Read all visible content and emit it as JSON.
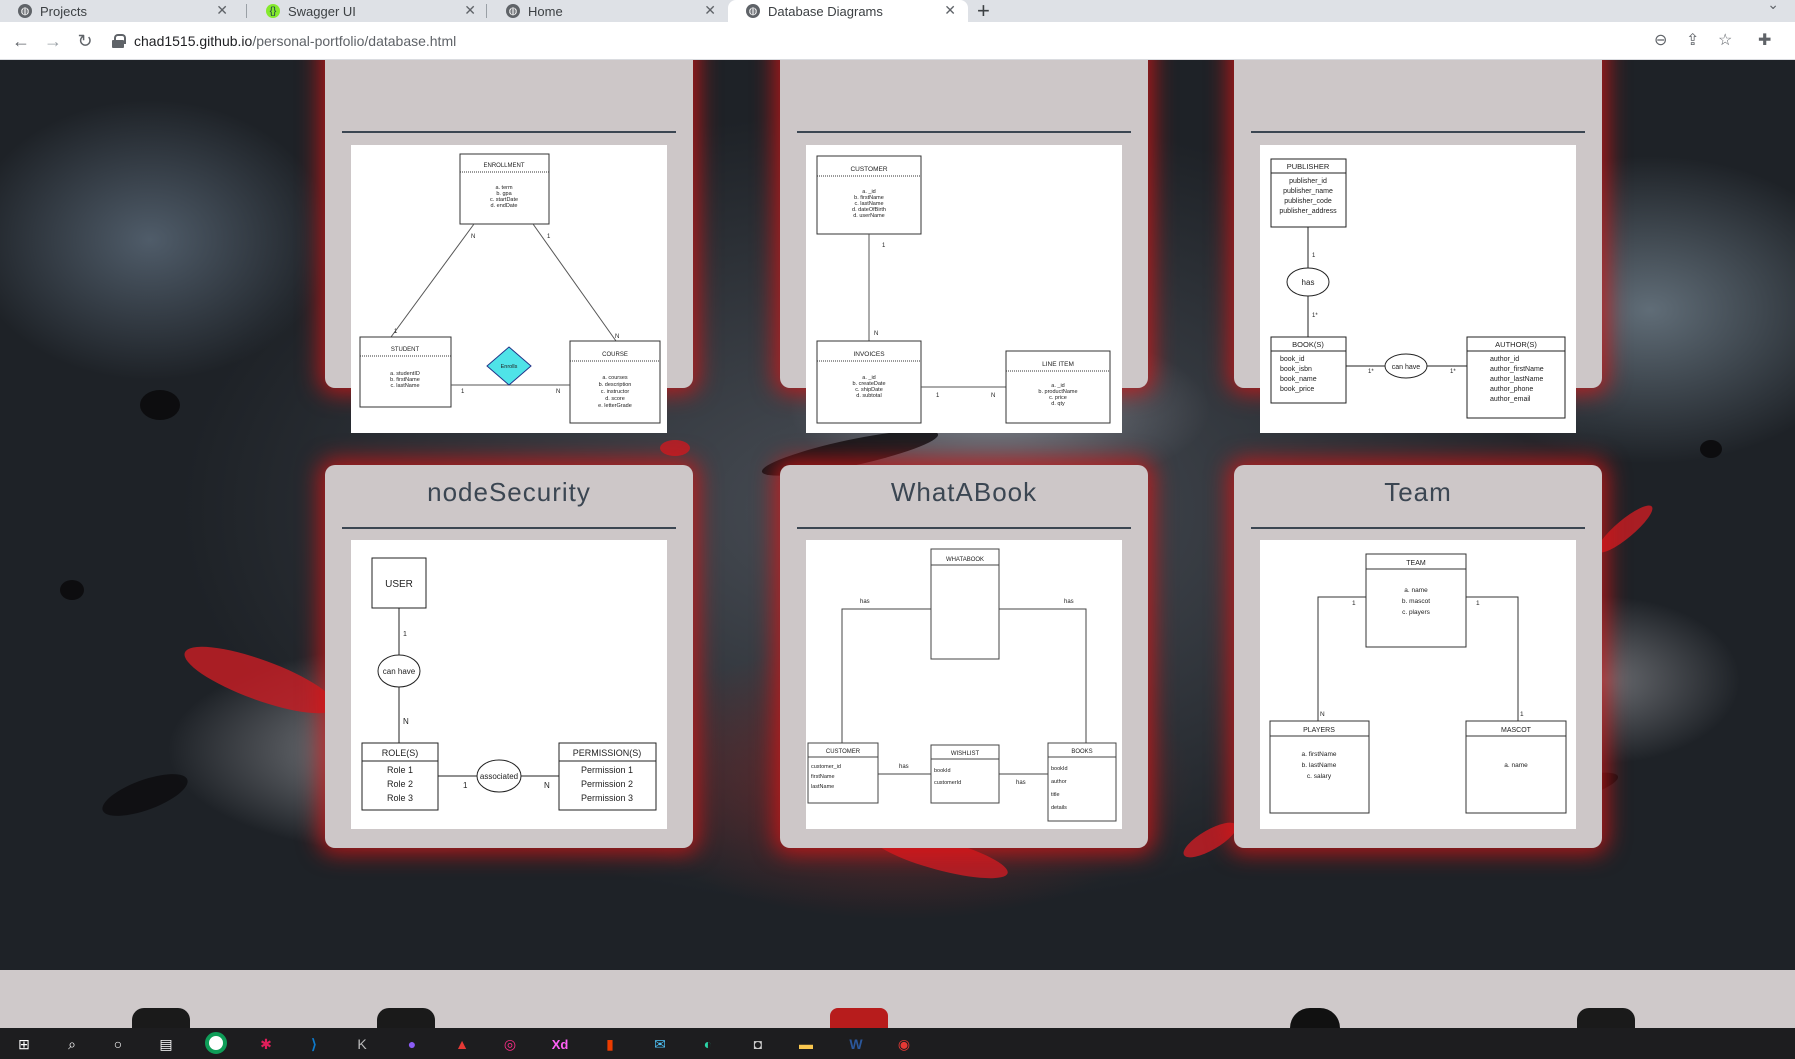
{
  "browser": {
    "tabs": [
      {
        "title": "Projects",
        "active": false
      },
      {
        "title": "Swagger UI",
        "active": false
      },
      {
        "title": "Home",
        "active": false
      },
      {
        "title": "Database Diagrams",
        "active": true
      }
    ],
    "url_domain": "chad1515.github.io",
    "url_path": "/personal-portfolio/database.html"
  },
  "cards": [
    {
      "title": "",
      "diagram": {
        "enrollment": {
          "name": "ENROLLMENT",
          "attrs": [
            "a. term",
            "b. gpa",
            "c. startDate",
            "d. endDate"
          ]
        },
        "student": {
          "name": "STUDENT",
          "attrs": [
            "a. studentID",
            "b. firstName",
            "c. lastName"
          ]
        },
        "course": {
          "name": "COURSE",
          "attrs": [
            "a. courses",
            "b. description",
            "c. instructor",
            "d. score",
            "e. letterGrade"
          ]
        },
        "relation": "Enrolls",
        "labels": {
          "en_st": "N",
          "en_co": "1",
          "st_en": "1",
          "co_en": "N",
          "st_rel": "1",
          "co_rel": "N"
        }
      }
    },
    {
      "title": "",
      "diagram": {
        "customer": {
          "name": "CUSTOMER",
          "attrs": [
            "a. _id",
            "b. firstName",
            "c. lastName",
            "d. dateOfBirth",
            "d. userName"
          ]
        },
        "invoices": {
          "name": "INVOICES",
          "attrs": [
            "a. _id",
            "b. createDate",
            "c. shipDate",
            "d. subtotal"
          ]
        },
        "line_item": {
          "name": "LINE ITEM",
          "attrs": [
            "a. _id",
            "b. productName",
            "c. price",
            "d. qty"
          ]
        },
        "labels": {
          "cu_in_top": "1",
          "cu_in_bot": "N",
          "in_li_left": "1",
          "in_li_right": "N"
        }
      }
    },
    {
      "title": "",
      "diagram": {
        "publisher": {
          "name": "PUBLISHER",
          "attrs": [
            "publisher_id",
            "publisher_name",
            "publisher_code",
            "publisher_address"
          ]
        },
        "books": {
          "name": "BOOK(S)",
          "attrs": [
            "book_id",
            "book_isbn",
            "book_name",
            "book_price"
          ]
        },
        "authors": {
          "name": "AUTHOR(S)",
          "attrs": [
            "author_id",
            "author_firstName",
            "author_lastName",
            "author_phone",
            "author_email"
          ]
        },
        "rel_has": "has",
        "rel_canhave": "can have",
        "labels": {
          "pub": "1",
          "book_top": "1*",
          "book_right": "1*",
          "auth_left": "1*"
        }
      }
    },
    {
      "title": "nodeSecurity",
      "diagram": {
        "user": "USER",
        "rel_canhave": "can have",
        "roles": {
          "name": "ROLE(S)",
          "attrs": [
            "Role 1",
            "Role 2",
            "Role 3"
          ]
        },
        "permissions": {
          "name": "PERMISSION(S)",
          "attrs": [
            "Permission 1",
            "Permission 2",
            "Permission 3"
          ]
        },
        "rel_assoc": "associated",
        "labels": {
          "user": "1",
          "role_top": "N",
          "role_right": "1",
          "perm_left": "N"
        }
      }
    },
    {
      "title": "WhatABook",
      "diagram": {
        "whatabook": "WHATABOOK",
        "customer": {
          "name": "CUSTOMER",
          "attrs": [
            "customer_id",
            "firstName",
            "lastName"
          ]
        },
        "wishlist": {
          "name": "WISHLIST",
          "attrs": [
            "bookId",
            "customerId"
          ]
        },
        "books": {
          "name": "BOOKS",
          "attrs": [
            "bookId",
            "author",
            "title",
            "details"
          ]
        },
        "labels": {
          "has_left": "has",
          "has_right": "has",
          "has_mid": "has",
          "has_books": "has"
        }
      }
    },
    {
      "title": "Team",
      "diagram": {
        "team": {
          "name": "TEAM",
          "attrs": [
            "a. name",
            "b. mascot",
            "c. players"
          ]
        },
        "players": {
          "name": "PLAYERS",
          "attrs": [
            "a. firstName",
            "b. lastName",
            "c. salary"
          ]
        },
        "mascot": {
          "name": "MASCOT",
          "attrs": [
            "a. name"
          ]
        },
        "labels": {
          "team_left": "1",
          "team_right": "1",
          "players": "N",
          "mascot": "1"
        }
      }
    }
  ],
  "taskbar": [
    "windows-start",
    "search",
    "cortana",
    "task-view",
    "chrome",
    "slack",
    "vscode",
    "keystroke",
    "github-desktop",
    "acrobat",
    "creative-cloud",
    "adobe-xd",
    "office",
    "mail",
    "edge",
    "camera",
    "file-explorer",
    "word",
    "recorder"
  ]
}
